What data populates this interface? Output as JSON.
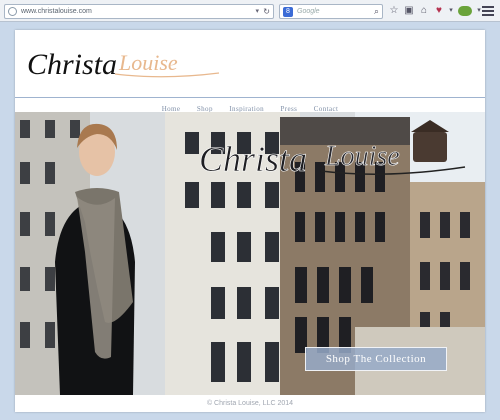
{
  "browser": {
    "url": "www.christalouise.com",
    "search_engine": "Google",
    "search_placeholder": "Google"
  },
  "site": {
    "logo_text_part1": "Christa",
    "logo_text_part2": "Louise",
    "nav": [
      "Home",
      "Shop",
      "Inspiration",
      "Press",
      "Contact"
    ],
    "cta_label": "Shop The Collection",
    "footer": "© Christa Louise, LLC 2014"
  },
  "colors": {
    "nav_text": "#7f8fa7",
    "logo_accent": "#e8b88e",
    "cta_bg": "#96aac8"
  }
}
